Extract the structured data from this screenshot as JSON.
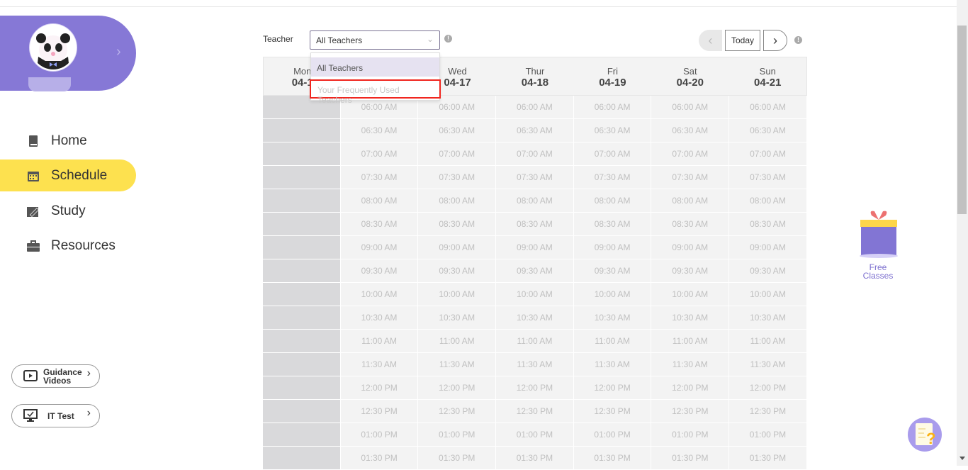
{
  "sidebar": {
    "nav": [
      {
        "label": "Home",
        "icon": "book-icon"
      },
      {
        "label": "Schedule",
        "icon": "calendar-icon",
        "active": true
      },
      {
        "label": "Study",
        "icon": "pencil-icon"
      },
      {
        "label": "Resources",
        "icon": "briefcase-icon"
      }
    ],
    "guidance_label_1": "Guidance",
    "guidance_label_2": "Videos",
    "it_test_label": "IT Test"
  },
  "filter": {
    "label": "Teacher",
    "selected": "All Teachers",
    "options": [
      "All Teachers",
      "Your Frequently Used Teachers"
    ]
  },
  "week_nav": {
    "today_label": "Today"
  },
  "calendar": {
    "days": [
      {
        "day": "Mon",
        "date": "04-1"
      },
      {
        "day": "",
        "date": ""
      },
      {
        "day": "Wed",
        "date": "04-17"
      },
      {
        "day": "Thur",
        "date": "04-18"
      },
      {
        "day": "Fri",
        "date": "04-19"
      },
      {
        "day": "Sat",
        "date": "04-20"
      },
      {
        "day": "Sun",
        "date": "04-21"
      }
    ],
    "times": [
      "06:00 AM",
      "06:30 AM",
      "07:00 AM",
      "07:30 AM",
      "08:00 AM",
      "08:30 AM",
      "09:00 AM",
      "09:30 AM",
      "10:00 AM",
      "10:30 AM",
      "11:00 AM",
      "11:30 AM",
      "12:00 PM",
      "12:30 PM",
      "01:00 PM",
      "01:30 PM"
    ]
  },
  "promo": {
    "free_1": "Free",
    "free_2": "Classes"
  },
  "colors": {
    "brand": "#8678d6",
    "active_nav": "#fde14f",
    "highlight": "#f0261f"
  }
}
